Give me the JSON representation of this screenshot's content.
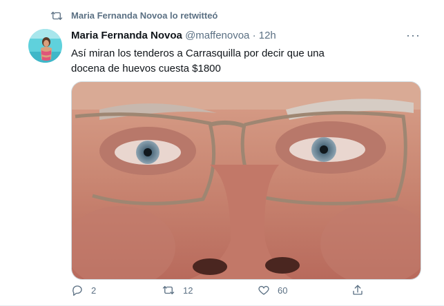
{
  "retweet": {
    "text": "Maria Fernanda Novoa lo retwitteó",
    "icon": "retweet-icon"
  },
  "tweet": {
    "author_name": "Maria Fernanda Novoa",
    "handle": "@maffenovoa",
    "separator": "·",
    "time": "12h",
    "more_icon": "more-icon",
    "more_glyph": "···",
    "text": "Así miran los tenderos a Carrasquilla por decir que una docena de huevos cuesta $1800",
    "actions": {
      "reply": {
        "icon": "reply-icon",
        "count": "2"
      },
      "retweet": {
        "icon": "retweet-icon",
        "count": "12"
      },
      "like": {
        "icon": "heart-icon",
        "count": "60"
      },
      "share": {
        "icon": "share-icon"
      }
    }
  },
  "colors": {
    "secondary_text": "#5b7083",
    "primary_text": "#0f1419",
    "border": "#cfd9de"
  }
}
